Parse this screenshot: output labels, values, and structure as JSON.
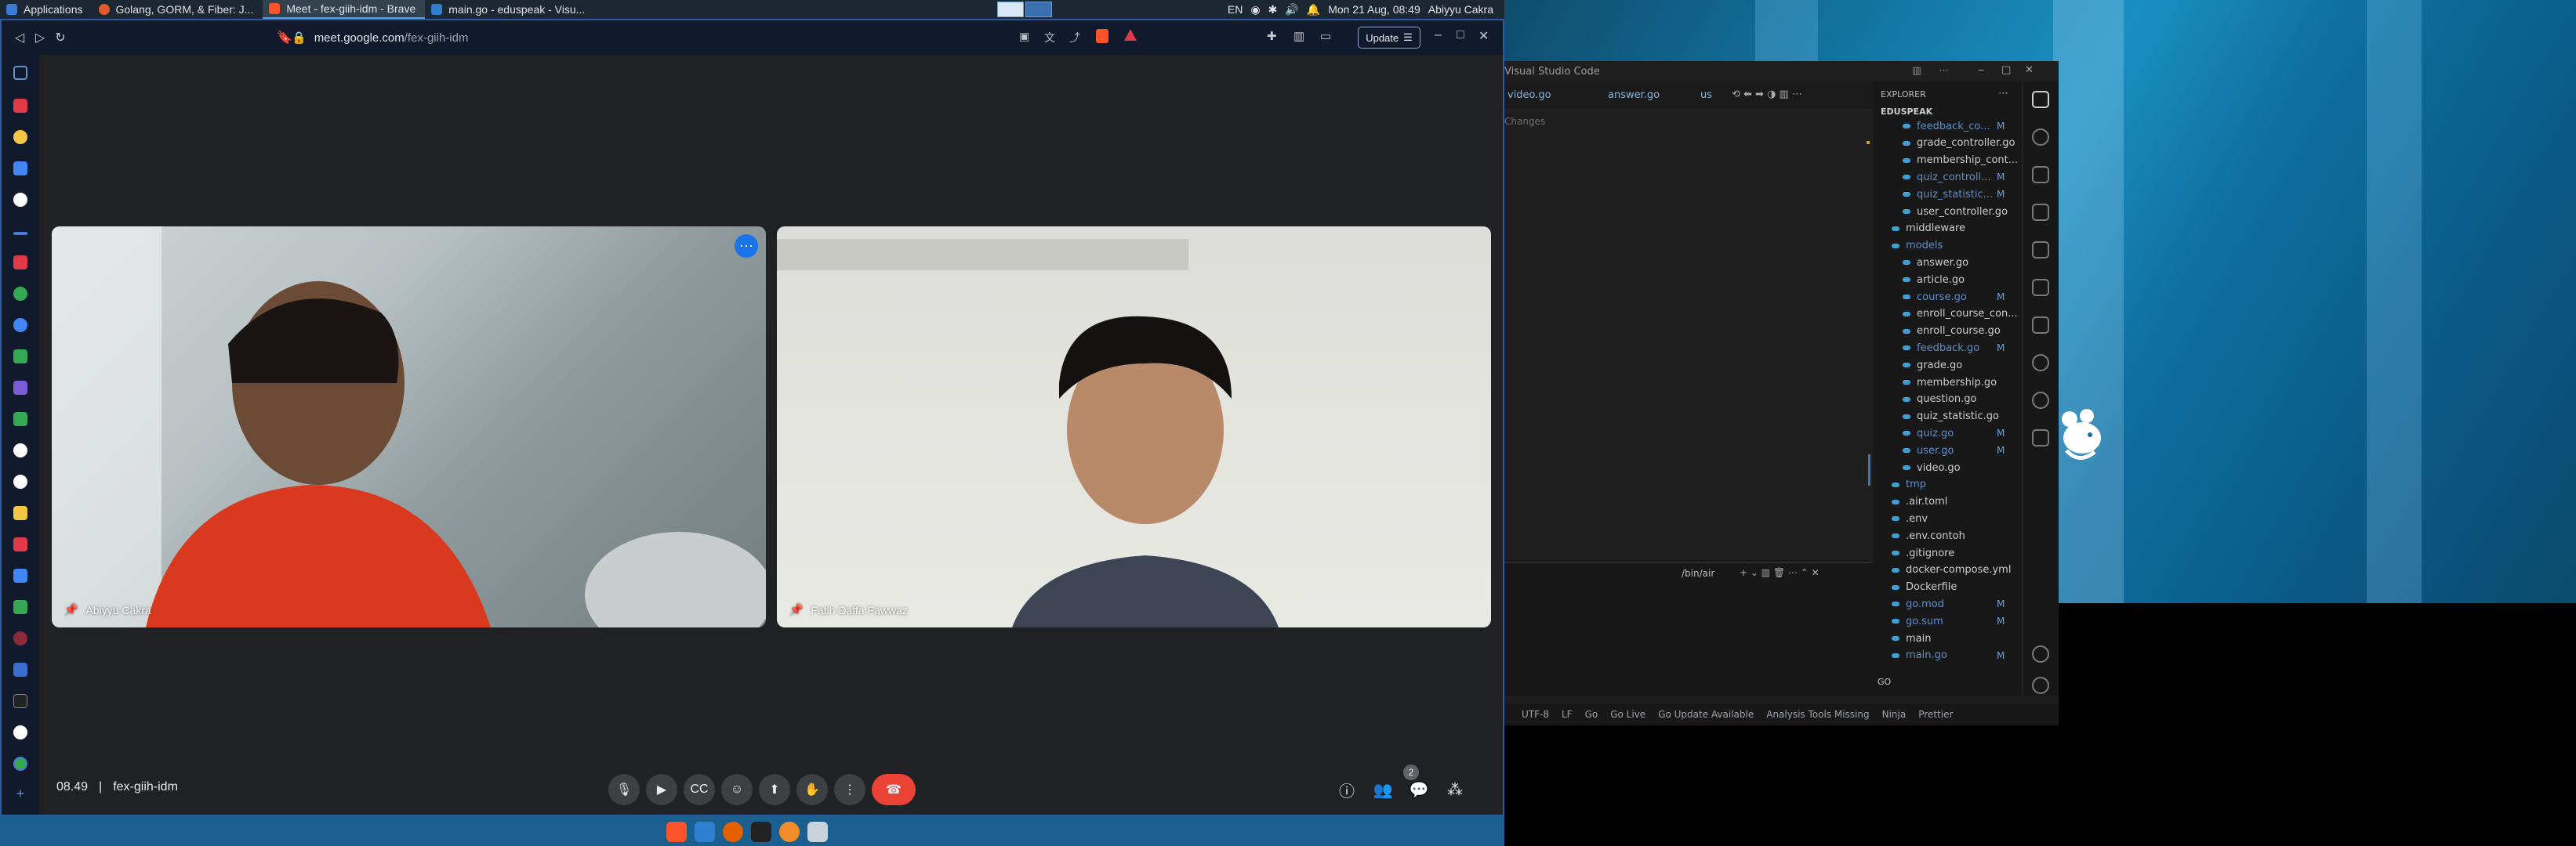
{
  "top_panel": {
    "applications_label": "Applications",
    "tasks": [
      {
        "label": "Golang, GORM, & Fiber: J...",
        "color": "#e05a2b"
      },
      {
        "label": "Meet - fex-giih-idm - Brave",
        "color": "#fb542b"
      },
      {
        "label": "main.go - eduspeak - Visu...",
        "color": "#2f80d1"
      }
    ],
    "lang": "EN",
    "datetime": "Mon 21 Aug, 08:49",
    "user": "Abiyyu Cakra"
  },
  "browser": {
    "url_host": "meet.google.com",
    "url_path": "/fex-giih-idm",
    "update_label": "Update",
    "accent": "#1a73e8"
  },
  "meet": {
    "participants": [
      {
        "name": "Abiyyu Cakra"
      },
      {
        "name": "Fatih Daffa Fawwaz"
      }
    ],
    "time": "08.49",
    "meeting_code": "fex-giih-idm",
    "participant_count": "2",
    "end_call_color": "#ea4335"
  },
  "vscode": {
    "title": "Visual Studio Code",
    "tabs": [
      "video.go",
      "answer.go",
      "us"
    ],
    "changes_label": "Changes",
    "terminal_label": "/bin/air",
    "explorer_title": "EXPLORER",
    "project": "EDUSPEAK",
    "files": [
      {
        "name": "feedback_co...",
        "indent": 1,
        "badge": "M",
        "modified": true
      },
      {
        "name": "grade_controller.go",
        "indent": 1,
        "badge": "",
        "modified": false
      },
      {
        "name": "membership_cont...",
        "indent": 1,
        "badge": "",
        "modified": false
      },
      {
        "name": "quiz_controll...",
        "indent": 1,
        "badge": "M",
        "modified": true
      },
      {
        "name": "quiz_statistic...",
        "indent": 1,
        "badge": "M",
        "modified": true
      },
      {
        "name": "user_controller.go",
        "indent": 1,
        "badge": "",
        "modified": false
      },
      {
        "name": "middleware",
        "indent": 0,
        "badge": "",
        "modified": false
      },
      {
        "name": "models",
        "indent": 0,
        "badge": "",
        "modified": true
      },
      {
        "name": "answer.go",
        "indent": 1,
        "badge": "",
        "modified": false
      },
      {
        "name": "article.go",
        "indent": 1,
        "badge": "",
        "modified": false
      },
      {
        "name": "course.go",
        "indent": 1,
        "badge": "M",
        "modified": true
      },
      {
        "name": "enroll_course_con...",
        "indent": 1,
        "badge": "",
        "modified": false
      },
      {
        "name": "enroll_course.go",
        "indent": 1,
        "badge": "",
        "modified": false
      },
      {
        "name": "feedback.go",
        "indent": 1,
        "badge": "M",
        "modified": true
      },
      {
        "name": "grade.go",
        "indent": 1,
        "badge": "",
        "modified": false
      },
      {
        "name": "membership.go",
        "indent": 1,
        "badge": "",
        "modified": false
      },
      {
        "name": "question.go",
        "indent": 1,
        "badge": "",
        "modified": false
      },
      {
        "name": "quiz_statistic.go",
        "indent": 1,
        "badge": "",
        "modified": false
      },
      {
        "name": "quiz.go",
        "indent": 1,
        "badge": "M",
        "modified": true
      },
      {
        "name": "user.go",
        "indent": 1,
        "badge": "M",
        "modified": true
      },
      {
        "name": "video.go",
        "indent": 1,
        "badge": "",
        "modified": false
      },
      {
        "name": "tmp",
        "indent": 0,
        "badge": "",
        "modified": true
      },
      {
        "name": ".air.toml",
        "indent": 0,
        "badge": "",
        "modified": false
      },
      {
        "name": ".env",
        "indent": 0,
        "badge": "",
        "modified": false
      },
      {
        "name": ".env.contoh",
        "indent": 0,
        "badge": "",
        "modified": false
      },
      {
        "name": ".gitignore",
        "indent": 0,
        "badge": "",
        "modified": false
      },
      {
        "name": "docker-compose.yml",
        "indent": 0,
        "badge": "",
        "modified": false
      },
      {
        "name": "Dockerfile",
        "indent": 0,
        "badge": "",
        "modified": false
      },
      {
        "name": "go.mod",
        "indent": 0,
        "badge": "M",
        "modified": true
      },
      {
        "name": "go.sum",
        "indent": 0,
        "badge": "M",
        "modified": true
      },
      {
        "name": "main",
        "indent": 0,
        "badge": "",
        "modified": false
      },
      {
        "name": "main.go",
        "indent": 0,
        "badge": "M",
        "modified": true
      }
    ],
    "go_section": "GO",
    "status_items": [
      "UTF-8",
      "LF",
      "Go",
      "Go Live",
      "Go Update Available",
      "Analysis Tools Missing",
      "Ninja",
      "Prettier"
    ]
  }
}
